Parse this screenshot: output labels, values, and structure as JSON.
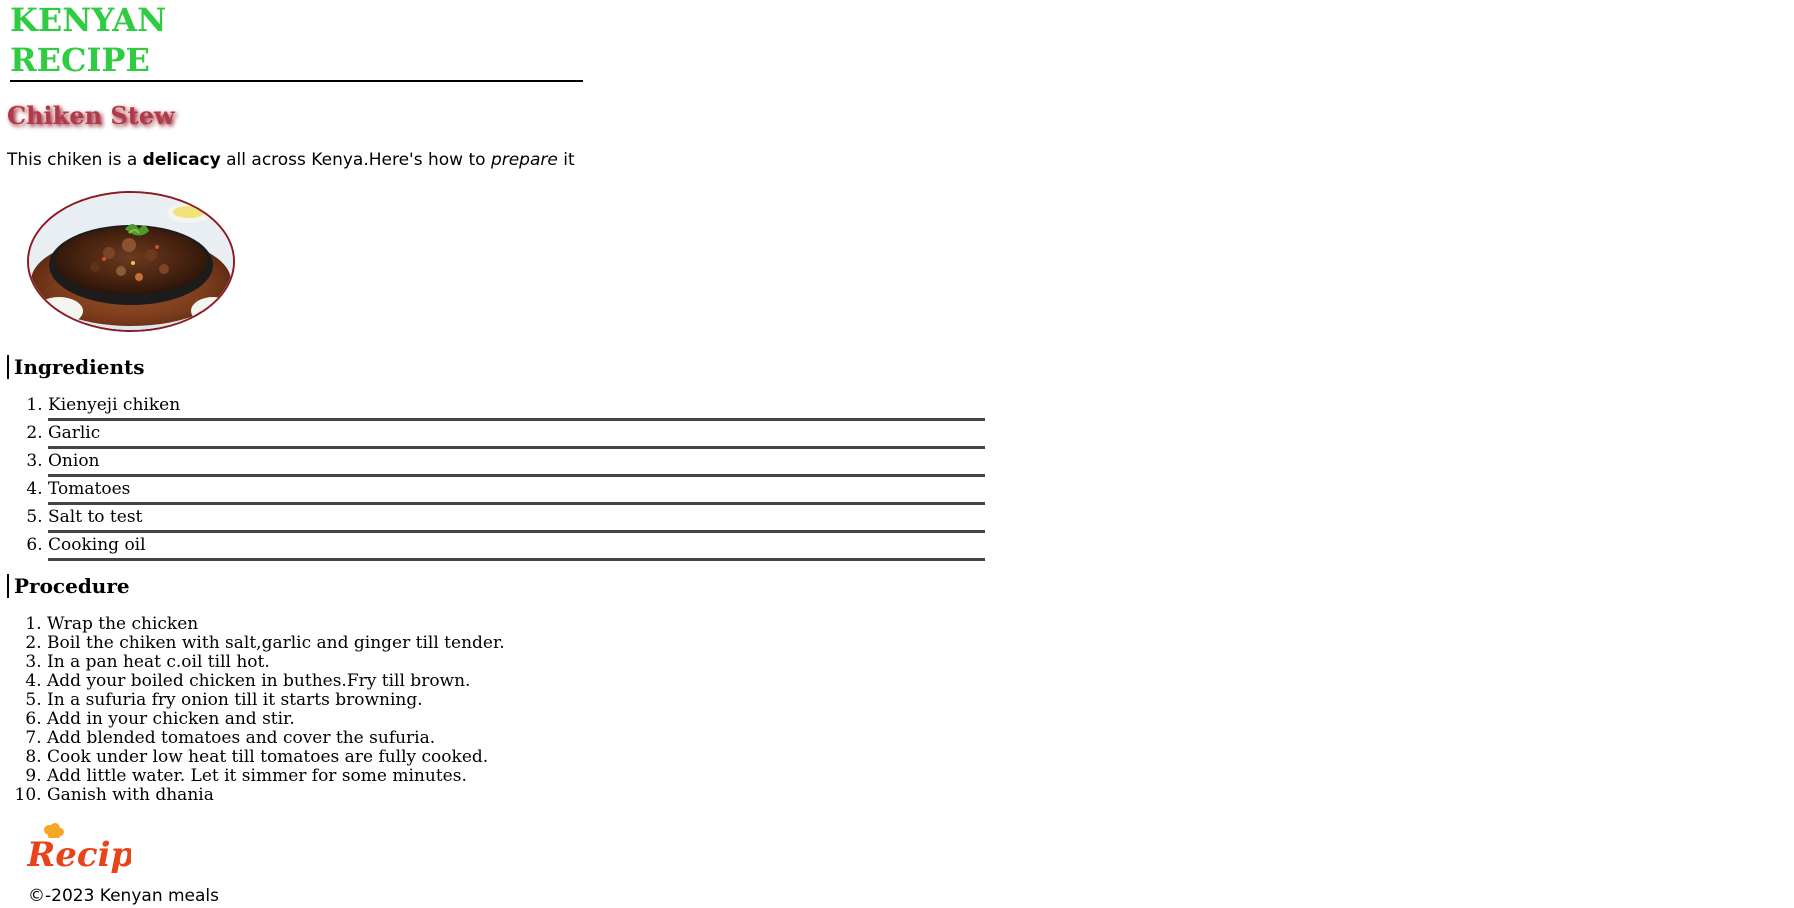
{
  "brand": {
    "line1": "KENYAN",
    "line2": "RECIPE",
    "color": "#2ecc40"
  },
  "dish": {
    "title": "Chiken Stew",
    "title_color": "#b03a48",
    "intro_part1": "This chiken is a ",
    "intro_bold": "delicacy",
    "intro_part2": " all across Kenya.Here's how to ",
    "intro_italic": "prepare",
    "intro_part3": " it",
    "photo_icon": "chicken-stew-photo"
  },
  "ingredients": {
    "heading": "Ingredients",
    "items": [
      "Kienyeji chiken",
      "Garlic",
      "Onion",
      "Tomatoes",
      "Salt to test",
      "Cooking oil"
    ]
  },
  "procedure": {
    "heading": "Procedure",
    "steps": [
      "Wrap the chicken",
      "Boil the chiken with salt,garlic and ginger till tender.",
      "In a pan heat c.oil till hot.",
      "Add your boiled chicken in buthes.Fry till brown.",
      "In a sufuria fry onion till it starts browning.",
      "Add in your chicken and stir.",
      "Add blended tomatoes and cover the sufuria.",
      "Cook under low heat till tomatoes are fully cooked.",
      "Add little water. Let it simmer for some minutes.",
      "Ganish with dhania"
    ]
  },
  "logo": {
    "text": "Recipes",
    "color": "#e8431a",
    "accent": "#f5a623"
  },
  "footer": {
    "copyright": "©-2023 Kenyan meals"
  }
}
